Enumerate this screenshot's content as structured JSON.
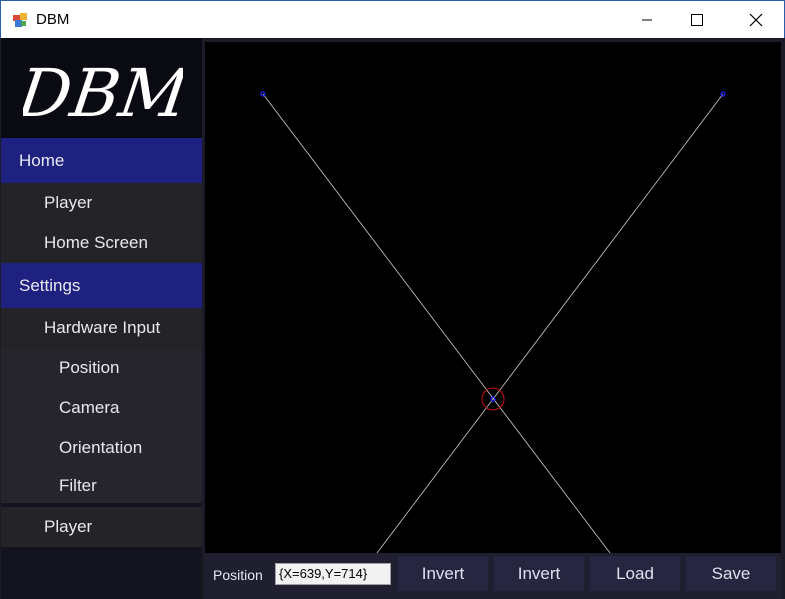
{
  "window": {
    "title": "DBM",
    "controls": {
      "minimize": "minimize-icon",
      "maximize": "maximize-icon",
      "close": "close-icon"
    }
  },
  "sidebar": {
    "logo_text": "DBM",
    "items": [
      {
        "label": "Home",
        "level": 0,
        "selected": true
      },
      {
        "label": "Player",
        "level": 1
      },
      {
        "label": "Home Screen",
        "level": 1
      },
      {
        "label": "Settings",
        "level": 0,
        "selected": true
      },
      {
        "label": "Hardware Input",
        "level": 1
      },
      {
        "label": "Position",
        "level": 2
      },
      {
        "label": "Camera",
        "level": 2
      },
      {
        "label": "Orientation",
        "level": 2
      },
      {
        "label": "Filter",
        "level": 2
      },
      {
        "label": "Player",
        "level": 1
      }
    ]
  },
  "canvas": {
    "background": "#000000",
    "line_color": "#d0d0d0",
    "point_color": "#2020ff",
    "marker_color": "#cc1111"
  },
  "bottom_bar": {
    "position_label": "Position",
    "position_value": "{X=639,Y=714}",
    "buttons": [
      "Invert",
      "Invert",
      "Load",
      "Save"
    ]
  },
  "colors": {
    "accent": "#1f2180",
    "titlebar_border": "#2a5ea8"
  }
}
